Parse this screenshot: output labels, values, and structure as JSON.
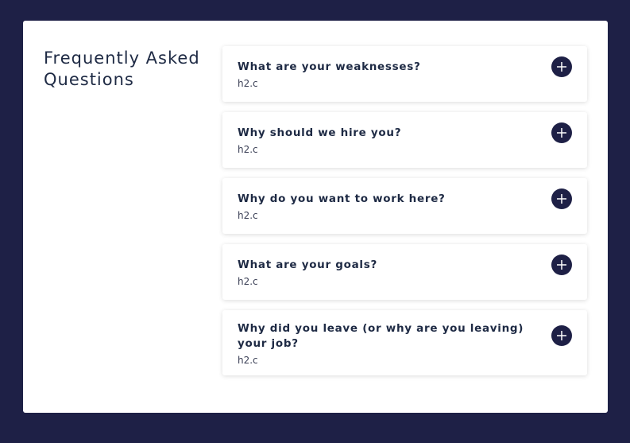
{
  "page": {
    "title": "Frequently Asked Questions"
  },
  "colors": {
    "background": "#1e2046",
    "card": "#ffffff",
    "text": "#1e2a44",
    "toggle_bg": "#1e2046",
    "toggle_icon": "#ffffff"
  },
  "faq": {
    "items": [
      {
        "question": "What are your weaknesses?",
        "answer": "h2.c",
        "icon": "plus-icon"
      },
      {
        "question": "Why should we hire you?",
        "answer": "h2.c",
        "icon": "plus-icon"
      },
      {
        "question": "Why do you want to work here?",
        "answer": "h2.c",
        "icon": "plus-icon"
      },
      {
        "question": "What are your goals?",
        "answer": "h2.c",
        "icon": "plus-icon"
      },
      {
        "question": "Why did you leave (or why are you leaving) your job?",
        "answer": "h2.c",
        "icon": "plus-icon"
      }
    ]
  }
}
